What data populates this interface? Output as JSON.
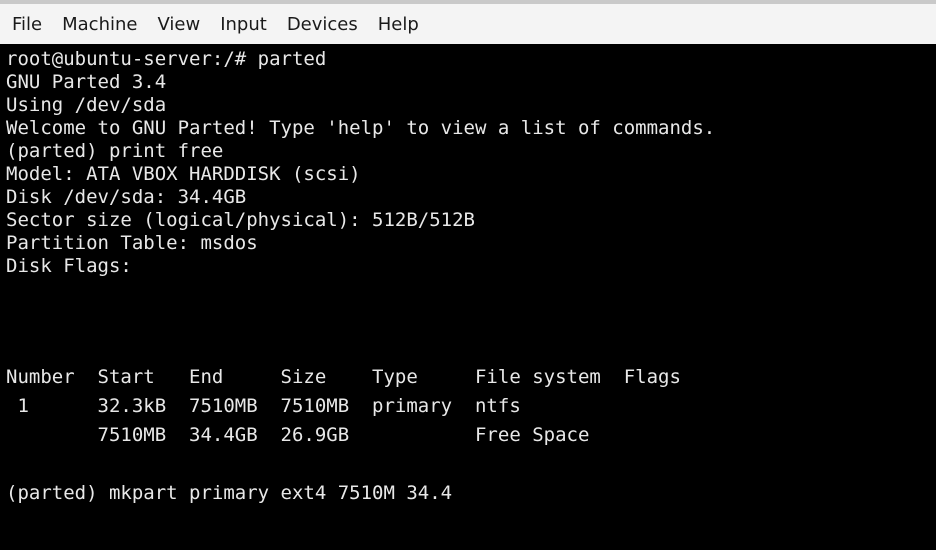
{
  "menubar": {
    "items": [
      "File",
      "Machine",
      "View",
      "Input",
      "Devices",
      "Help"
    ]
  },
  "terminal": {
    "lines": [
      "root@ubuntu-server:/# parted",
      "GNU Parted 3.4",
      "Using /dev/sda",
      "Welcome to GNU Parted! Type 'help' to view a list of commands.",
      "(parted) print free",
      "Model: ATA VBOX HARDDISK (scsi)",
      "Disk /dev/sda: 34.4GB",
      "Sector size (logical/physical): 512B/512B",
      "Partition Table: msdos",
      "Disk Flags:",
      "",
      "Number  Start   End     Size    Type     File system  Flags",
      " 1      32.3kB  7510MB  7510MB  primary  ntfs",
      "        7510MB  34.4GB  26.9GB           Free Space",
      "",
      "(parted) mkpart primary ext4 7510M 34.4"
    ]
  }
}
